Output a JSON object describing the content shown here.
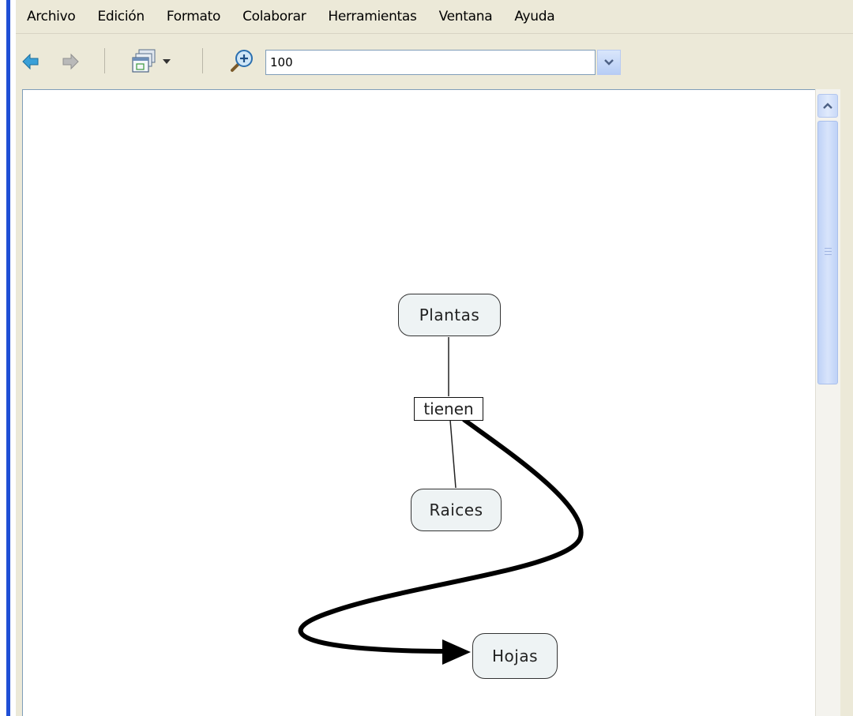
{
  "menubar": {
    "items": [
      "Archivo",
      "Edición",
      "Formato",
      "Colaborar",
      "Herramientas",
      "Ventana",
      "Ayuda"
    ]
  },
  "toolbar": {
    "back_icon": "back-arrow-icon",
    "forward_icon": "forward-arrow-icon",
    "view_icon": "window-view-icon",
    "zoom_icon": "zoom-in-icon",
    "zoom_value": "100"
  },
  "concept_map": {
    "concepts": [
      "Plantas",
      "Raices",
      "Hojas"
    ],
    "linking_phrase": "tienen",
    "link_color": "#000000",
    "node_fill": "#eef3f4"
  }
}
